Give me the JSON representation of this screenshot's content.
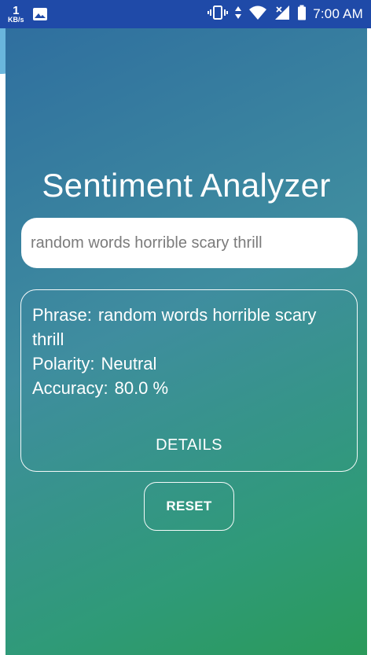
{
  "status_bar": {
    "net_speed_value": "1",
    "net_speed_unit": "KB/s",
    "time": "7:00 AM",
    "icons": [
      "image-icon",
      "vibrate-icon",
      "data-arrows-icon",
      "wifi-icon",
      "signal-off-icon",
      "battery-icon"
    ]
  },
  "app": {
    "title": "Sentiment Analyzer",
    "input_value": "random words horrible scary thrill",
    "result": {
      "phrase_label": "Phrase:",
      "phrase_value": "random words horrible scary thrill",
      "polarity_label": "Polarity:",
      "polarity_value": "Neutral",
      "accuracy_label": "Accuracy:",
      "accuracy_value": "80.0 %",
      "details_label": "DETAILS"
    },
    "reset_label": "RESET"
  },
  "colors": {
    "status_bar": "#1f4aa8",
    "gradient_start": "#2f6f9f",
    "gradient_end": "#2a9a5a",
    "text": "#ffffff",
    "input_text": "#7b7b7b"
  }
}
